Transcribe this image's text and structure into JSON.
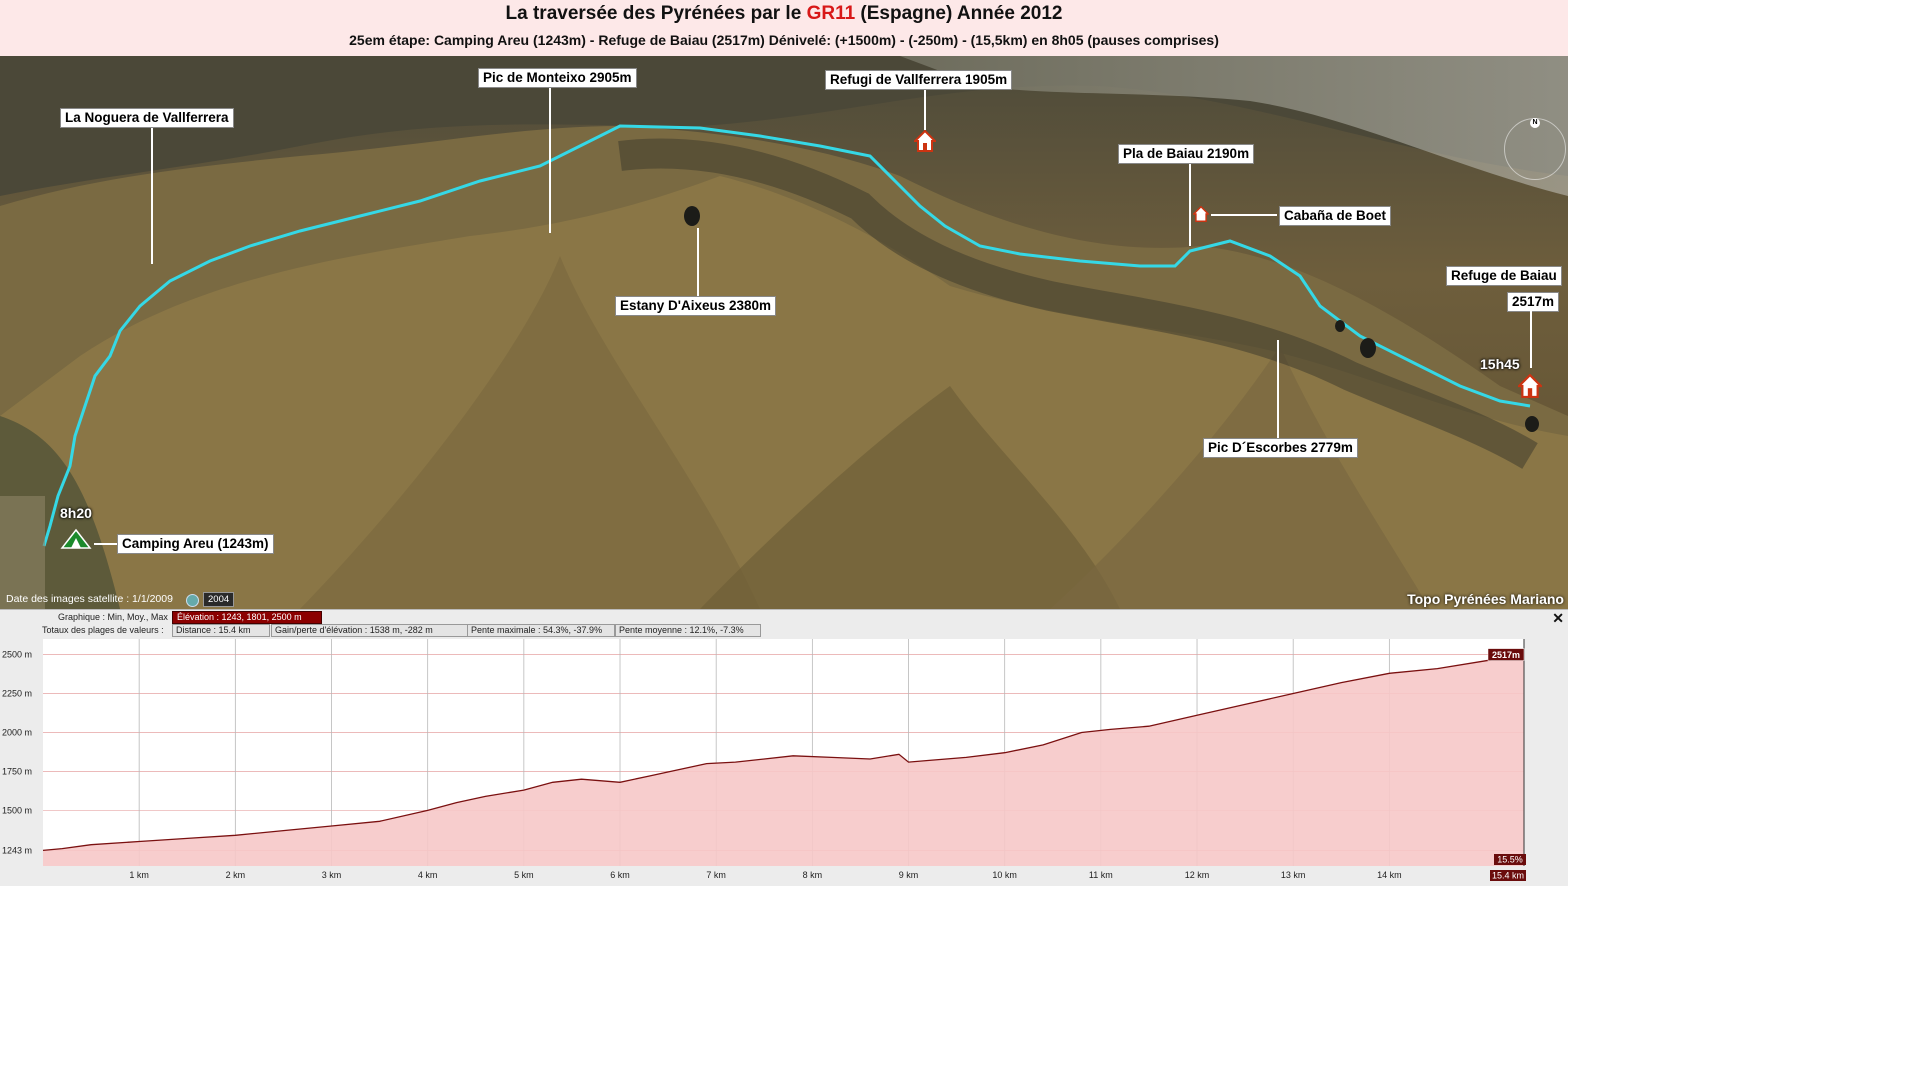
{
  "header": {
    "title_part1": "La traversée des Pyrénées par le ",
    "title_gr": "GR11",
    "title_part2": " (Espagne) Année 2012",
    "subtitle": "25em étape: Camping Areu (1243m) - Refuge de Baiau  (2517m) Dénivelé: (+1500m) - (-250m) - (15,5km) en 8h05 (pauses comprises)"
  },
  "map": {
    "labels": {
      "noguera": "La Noguera de Vallferrera",
      "monteixo": "Pic de Monteixo 2905m",
      "vallferrera": "Refugi de Vallferrera 1905m",
      "pla_baiau": "Pla de Baiau 2190m",
      "boet": "Cabaña de Boet",
      "refuge_baiau": "Refuge de Baiau",
      "refuge_alt": "2517m",
      "aixeus": "Estany D'Aixeus 2380m",
      "escorbes": "Pic D´Escorbes 2779m",
      "camping": "Camping Areu (1243m)"
    },
    "times": {
      "start": "8h20",
      "end": "15h45"
    },
    "satellite_date": "Date des images satellite : 1/1/2009",
    "year_button": "2004",
    "credit": "Topo Pyrénées Mariano",
    "colors": {
      "track": "#35d8e6",
      "terrain": "#6b5a35"
    },
    "icons": [
      "compass-icon",
      "camp-tent-icon",
      "refuge-icon",
      "clock-icon"
    ]
  },
  "infobar": {
    "graph_label": "Graphique : Min, Moy., Max",
    "elevation_value": "Élévation : 1243, 1801, 2500 m",
    "totals_label": "Totaux des plages de valeurs :",
    "distance": "Distance : 15.4 km",
    "gain_loss": "Gain/perte d'élévation : 1538 m, -282 m",
    "max_slope": "Pente maximale : 54.3%, -37.9%",
    "avg_slope": "Pente moyenne : 12.1%, -7.3%",
    "close": "✕"
  },
  "chart_data": {
    "type": "area",
    "xlabel": "",
    "ylabel": "",
    "xlim": [
      0,
      15.4
    ],
    "ylim": [
      1143,
      2600
    ],
    "y_ticks": [
      1243,
      1500,
      1750,
      2000,
      2250,
      2500
    ],
    "y_tick_labels": [
      "1243 m",
      "1500 m",
      "1750 m",
      "2000 m",
      "2250 m",
      "2500 m"
    ],
    "x_ticks": [
      1,
      2,
      3,
      4,
      5,
      6,
      7,
      8,
      9,
      10,
      11,
      12,
      13,
      14
    ],
    "x_tick_labels": [
      "1 km",
      "2 km",
      "3 km",
      "4 km",
      "5 km",
      "6 km",
      "7 km",
      "8 km",
      "9 km",
      "10 km",
      "11 km",
      "12 km",
      "13 km",
      "14 km"
    ],
    "end_x_label": "15.4 km",
    "end_value_label": "2517m",
    "slope_label": "15.5%",
    "series": [
      {
        "x": [
          0,
          0.2,
          0.5,
          1.0,
          1.5,
          2.0,
          2.5,
          3.0,
          3.5,
          4.0,
          4.3,
          4.6,
          5.0,
          5.3,
          5.6,
          6.0,
          6.3,
          6.6,
          6.9,
          7.2,
          7.5,
          7.8,
          8.2,
          8.6,
          8.9,
          9.0,
          9.2,
          9.6,
          10.0,
          10.4,
          10.8,
          11.1,
          11.5,
          12.0,
          12.5,
          13.0,
          13.5,
          14.0,
          14.5,
          15.0,
          15.4
        ],
        "y": [
          1243,
          1255,
          1280,
          1300,
          1320,
          1340,
          1370,
          1400,
          1430,
          1500,
          1550,
          1590,
          1630,
          1680,
          1700,
          1680,
          1720,
          1760,
          1800,
          1810,
          1830,
          1850,
          1840,
          1830,
          1860,
          1810,
          1820,
          1840,
          1870,
          1920,
          2000,
          2020,
          2040,
          2110,
          2180,
          2250,
          2320,
          2380,
          2410,
          2460,
          2500
        ]
      }
    ],
    "colors": {
      "line": "#7a1010",
      "fill": "#f6c8c8",
      "grid": "#e09090"
    }
  }
}
